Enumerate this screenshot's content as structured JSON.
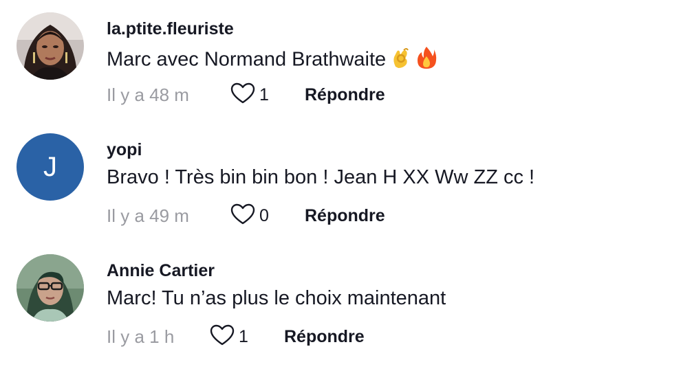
{
  "comments": [
    {
      "username": "la.ptite.fleuriste",
      "text": "Marc avec Normand Brathwaite",
      "emojis": [
        "ok-hand-emoji",
        "fire-emoji"
      ],
      "time": "Il y a 48 m",
      "likes": "1",
      "reply_label": "Répondre"
    },
    {
      "username": "yopi",
      "avatar_letter": "J",
      "avatar_color": "#2a62a6",
      "text": "Bravo ! Très bin bin bon ! Jean H XX Ww ZZ cc !",
      "time": "Il y a 49 m",
      "likes": "0",
      "reply_label": "Répondre"
    },
    {
      "username": "Annie Cartier",
      "text": "Marc! Tu n’as plus le choix maintenant",
      "time": "Il y a 1 h",
      "likes": "1",
      "reply_label": "Répondre"
    }
  ],
  "colors": {
    "text": "#161823",
    "meta": "#9a9ba1",
    "avatar_blue": "#2a62a6"
  }
}
